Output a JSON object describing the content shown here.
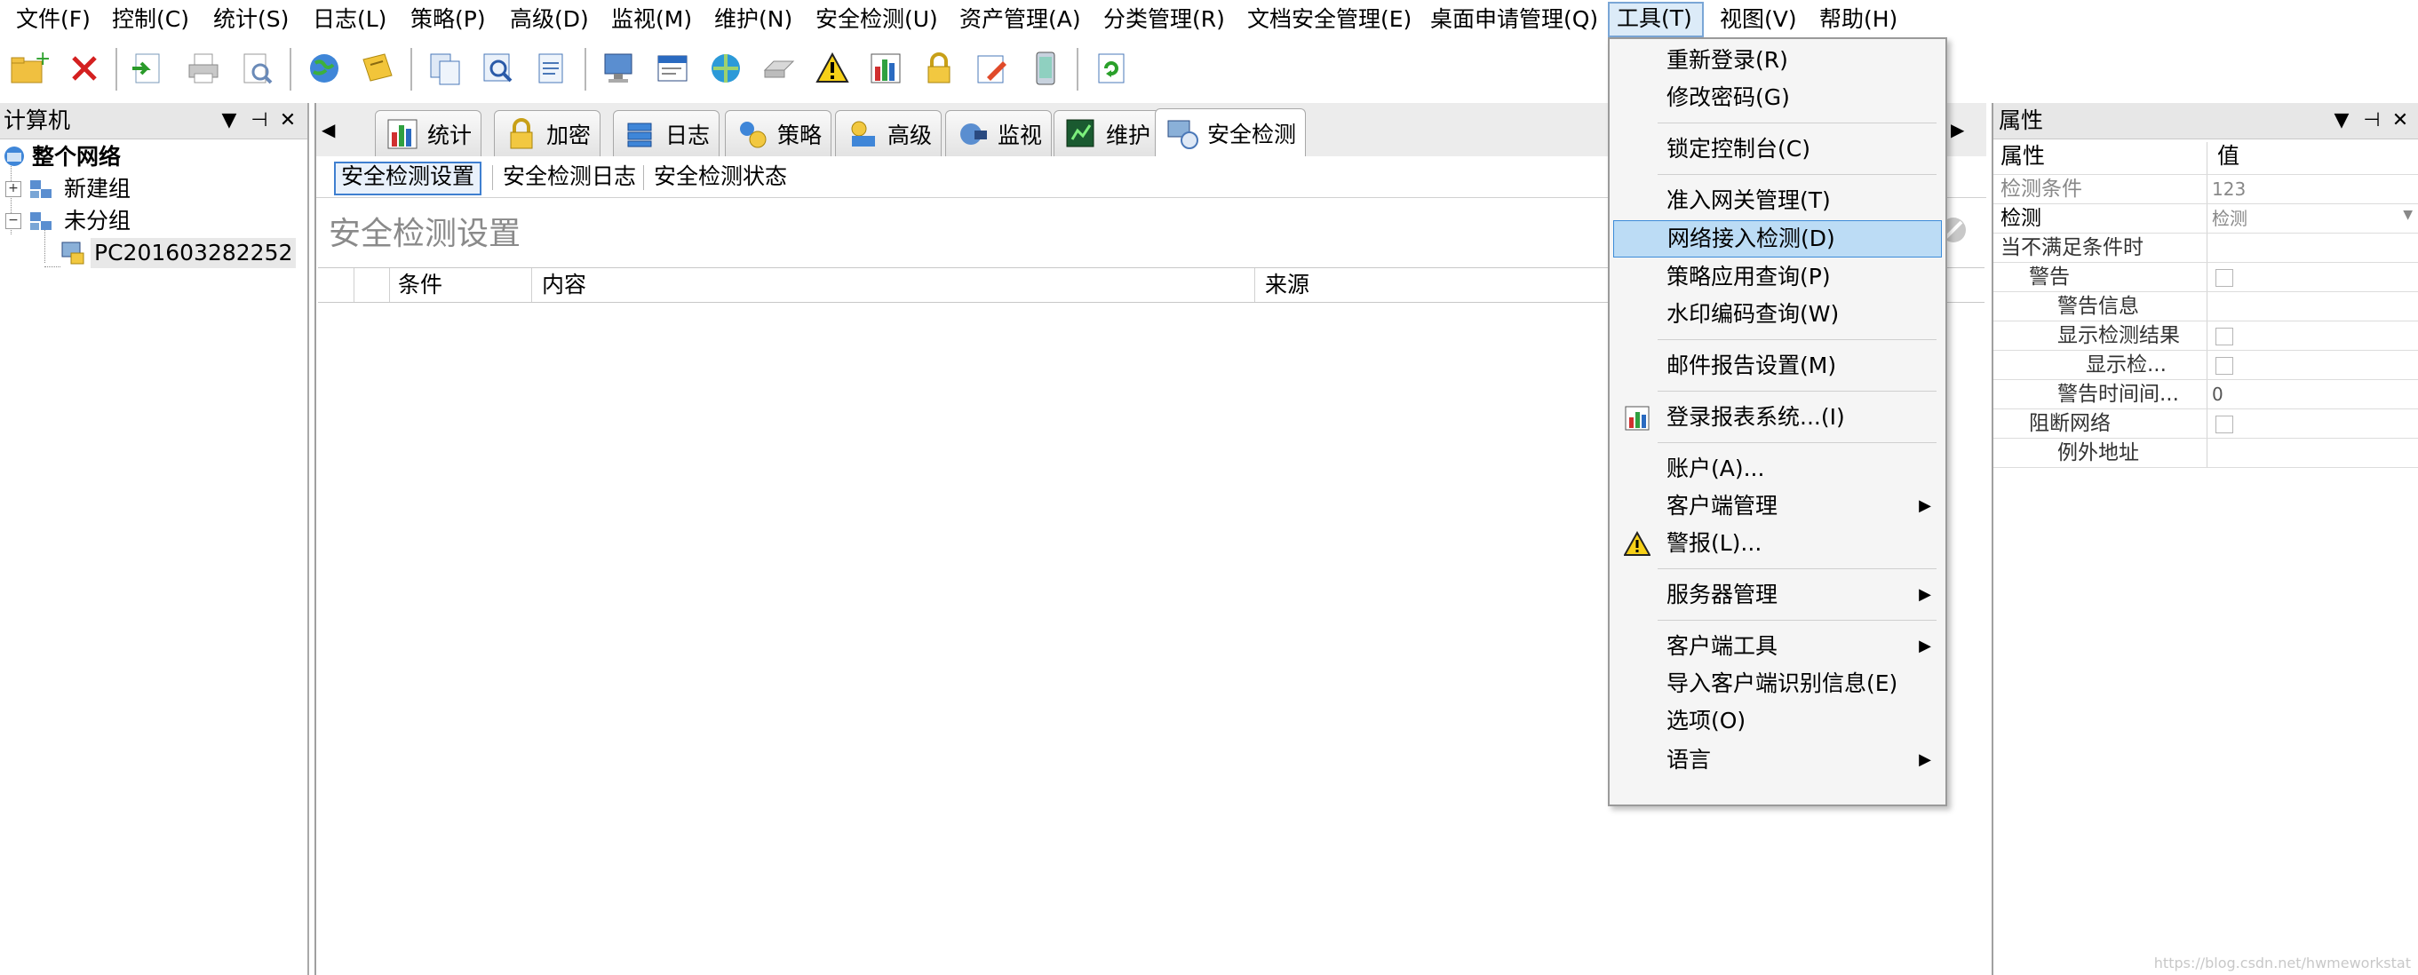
{
  "menubar": {
    "items": [
      {
        "label": "文件(F)"
      },
      {
        "label": "控制(C)"
      },
      {
        "label": "统计(S)"
      },
      {
        "label": "日志(L)"
      },
      {
        "label": "策略(P)"
      },
      {
        "label": "高级(D)"
      },
      {
        "label": "监视(M)"
      },
      {
        "label": "维护(N)"
      },
      {
        "label": "安全检测(U)"
      },
      {
        "label": "资产管理(A)"
      },
      {
        "label": "分类管理(R)"
      },
      {
        "label": "文档安全管理(E)"
      },
      {
        "label": "桌面申请管理(Q)"
      },
      {
        "label": "工具(T)"
      },
      {
        "label": "视图(V)"
      },
      {
        "label": "帮助(H)"
      }
    ]
  },
  "left_panel": {
    "title": "计算机",
    "tree": {
      "root": "整个网络",
      "group1": "新建组",
      "group2": "未分组",
      "computer": "PC201603282252"
    }
  },
  "center": {
    "tabs": [
      {
        "label": "统计"
      },
      {
        "label": "加密"
      },
      {
        "label": "日志"
      },
      {
        "label": "策略"
      },
      {
        "label": "高级"
      },
      {
        "label": "监视"
      },
      {
        "label": "维护"
      },
      {
        "label": "安全检测"
      }
    ],
    "subtabs": [
      {
        "label": "安全检测设置"
      },
      {
        "label": "安全检测日志"
      },
      {
        "label": "安全检测状态"
      }
    ],
    "page_title": "安全检测设置",
    "columns": [
      "条件",
      "内容",
      "来源"
    ]
  },
  "right_panel": {
    "title": "属性",
    "header_name": "属性",
    "header_value": "值",
    "rows": [
      {
        "name": "检测条件",
        "value": "123"
      },
      {
        "name": "检测",
        "value": "检测"
      },
      {
        "name": "当不满足条件时",
        "value": ""
      },
      {
        "name": "警告",
        "value": ""
      },
      {
        "name": "警告信息",
        "value": ""
      },
      {
        "name": "显示检测结果",
        "value": ""
      },
      {
        "name": "显示检...",
        "value": ""
      },
      {
        "name": "警告时间间...",
        "value": "0"
      },
      {
        "name": "阻断网络",
        "value": ""
      },
      {
        "name": "例外地址",
        "value": ""
      }
    ]
  },
  "tools_menu": {
    "items": [
      {
        "label": "重新登录(R)"
      },
      {
        "label": "修改密码(G)"
      },
      {
        "label": "锁定控制台(C)"
      },
      {
        "label": "准入网关管理(T)"
      },
      {
        "label": "网络接入检测(D)"
      },
      {
        "label": "策略应用查询(P)"
      },
      {
        "label": "水印编码查询(W)"
      },
      {
        "label": "邮件报告设置(M)"
      },
      {
        "label": "登录报表系统...(I)"
      },
      {
        "label": "账户(A)..."
      },
      {
        "label": "客户端管理"
      },
      {
        "label": "警报(L)..."
      },
      {
        "label": "服务器管理"
      },
      {
        "label": "客户端工具"
      },
      {
        "label": "导入客户端识别信息(E)"
      },
      {
        "label": "选项(O)"
      },
      {
        "label": "语言"
      }
    ]
  },
  "watermark": "https://blog.csdn.net/hwmeworkstat",
  "colors": {
    "highlight": "#bcdcf5",
    "highlight_border": "#3c8bd8",
    "menu_open": "#dcebf8"
  }
}
